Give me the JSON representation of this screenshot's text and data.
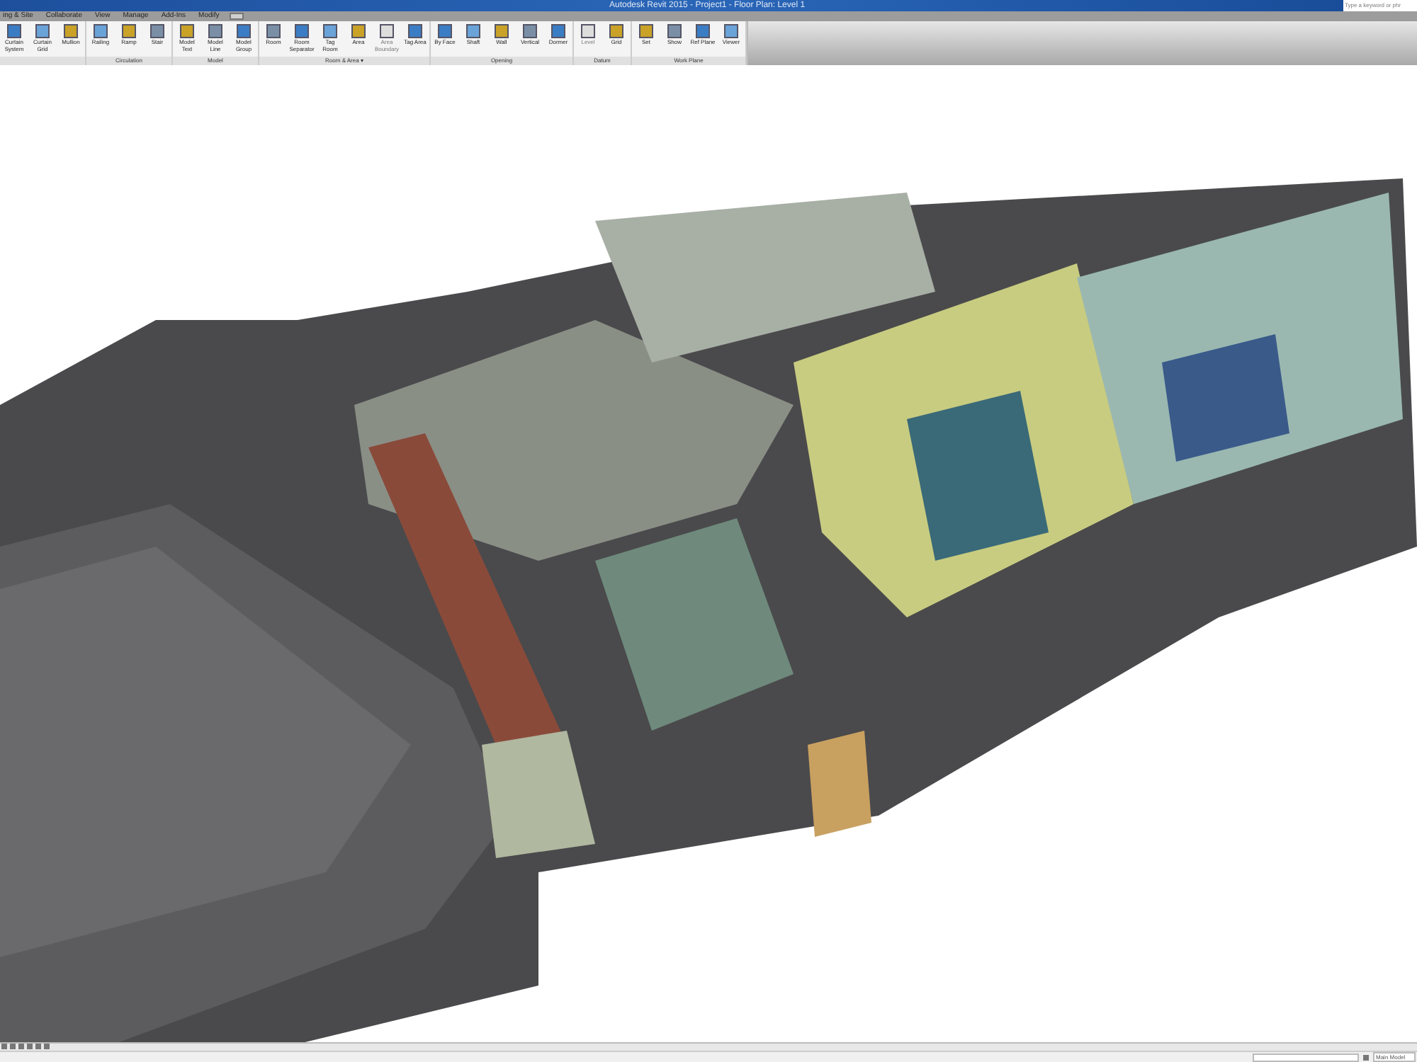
{
  "window": {
    "title": "Autodesk Revit 2015 -  Project1 - Floor Plan: Level 1"
  },
  "search": {
    "placeholder": "Type a keyword or phr"
  },
  "tabs": [
    {
      "label": "ing & Site",
      "selected": false
    },
    {
      "label": "Collaborate",
      "selected": false
    },
    {
      "label": "View",
      "selected": false
    },
    {
      "label": "Manage",
      "selected": false
    },
    {
      "label": "Add-Ins",
      "selected": false
    },
    {
      "label": "Modify",
      "selected": false
    }
  ],
  "ribbon": {
    "groups": [
      {
        "buttons": [
          {
            "label": "Curtain System",
            "disabled": false
          },
          {
            "label": "Curtain Grid",
            "disabled": false
          },
          {
            "label": "Mullion",
            "disabled": false
          }
        ]
      },
      {
        "title": "Circulation",
        "buttons": [
          {
            "label": "Railing",
            "disabled": false
          },
          {
            "label": "Ramp",
            "disabled": false
          },
          {
            "label": "Stair",
            "disabled": false
          }
        ]
      },
      {
        "title": "Model",
        "buttons": [
          {
            "label": "Model Text",
            "disabled": false
          },
          {
            "label": "Model Line",
            "disabled": false
          },
          {
            "label": "Model Group",
            "disabled": false
          }
        ]
      },
      {
        "title": "Room & Area ▾",
        "buttons": [
          {
            "label": "Room",
            "disabled": false
          },
          {
            "label": "Room Separator",
            "disabled": false
          },
          {
            "label": "Tag Room",
            "disabled": false
          },
          {
            "label": "Area",
            "disabled": false
          },
          {
            "label": "Area Boundary",
            "disabled": true
          },
          {
            "label": "Tag Area",
            "disabled": false
          }
        ]
      },
      {
        "title": "Opening",
        "buttons": [
          {
            "label": "By Face",
            "disabled": false
          },
          {
            "label": "Shaft",
            "disabled": false
          },
          {
            "label": "Wall",
            "disabled": false
          },
          {
            "label": "Vertical",
            "disabled": false
          },
          {
            "label": "Dormer",
            "disabled": false
          }
        ]
      },
      {
        "title": "Datum",
        "buttons": [
          {
            "label": "Level",
            "disabled": true
          },
          {
            "label": "Grid",
            "disabled": false
          }
        ]
      },
      {
        "title": "Work Plane",
        "buttons": [
          {
            "label": "Set",
            "disabled": false
          },
          {
            "label": "Show",
            "disabled": false
          },
          {
            "label": "Ref Plane",
            "disabled": false
          },
          {
            "label": "Viewer",
            "disabled": false
          }
        ]
      }
    ]
  },
  "status_bar": {
    "model": "Main Model"
  }
}
